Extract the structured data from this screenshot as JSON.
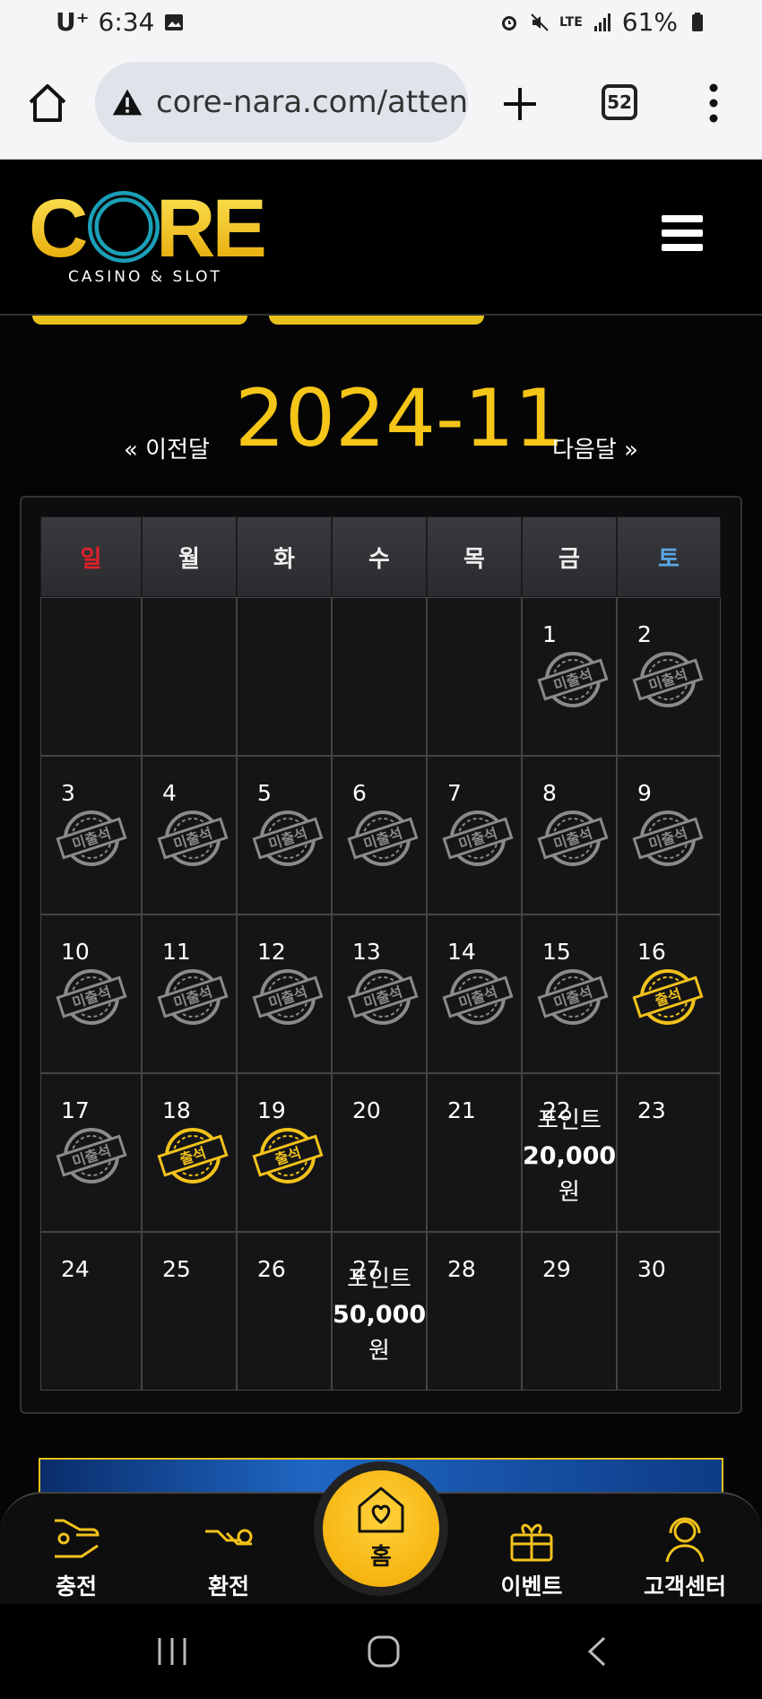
{
  "status_bar": {
    "carrier": "U⁺",
    "time": "6:34",
    "network": "LTE",
    "battery": "61%"
  },
  "browser": {
    "url": "core-nara.com/atten",
    "tab_count": "52"
  },
  "site": {
    "logo_text": "CORE",
    "logo_subtitle": "CASINO & SLOT"
  },
  "calendar": {
    "month_title": "2024-11",
    "prev_label": "« 이전달",
    "next_label": "다음달 »",
    "weekdays": [
      "일",
      "월",
      "화",
      "수",
      "목",
      "금",
      "토"
    ],
    "stamp_absent": "미출석",
    "stamp_present": "출석",
    "rows": [
      [
        {
          "day": ""
        },
        {
          "day": ""
        },
        {
          "day": ""
        },
        {
          "day": ""
        },
        {
          "day": ""
        },
        {
          "day": "1",
          "stamp": "absent"
        },
        {
          "day": "2",
          "stamp": "absent"
        }
      ],
      [
        {
          "day": "3",
          "stamp": "absent"
        },
        {
          "day": "4",
          "stamp": "absent"
        },
        {
          "day": "5",
          "stamp": "absent"
        },
        {
          "day": "6",
          "stamp": "absent"
        },
        {
          "day": "7",
          "stamp": "absent"
        },
        {
          "day": "8",
          "stamp": "absent"
        },
        {
          "day": "9",
          "stamp": "absent"
        }
      ],
      [
        {
          "day": "10",
          "stamp": "absent"
        },
        {
          "day": "11",
          "stamp": "absent"
        },
        {
          "day": "12",
          "stamp": "absent"
        },
        {
          "day": "13",
          "stamp": "absent"
        },
        {
          "day": "14",
          "stamp": "absent"
        },
        {
          "day": "15",
          "stamp": "absent"
        },
        {
          "day": "16",
          "stamp": "present"
        }
      ],
      [
        {
          "day": "17",
          "stamp": "absent"
        },
        {
          "day": "18",
          "stamp": "present"
        },
        {
          "day": "19",
          "stamp": "present"
        },
        {
          "day": "20"
        },
        {
          "day": "21"
        },
        {
          "day": "22",
          "reward": [
            "포인트",
            "20,000",
            "원"
          ]
        },
        {
          "day": "23"
        }
      ],
      [
        {
          "day": "24"
        },
        {
          "day": "25"
        },
        {
          "day": "26"
        },
        {
          "day": "27",
          "reward": [
            "포인트",
            "50,000",
            "원"
          ]
        },
        {
          "day": "28"
        },
        {
          "day": "29"
        },
        {
          "day": "30"
        }
      ]
    ]
  },
  "bottom_nav": {
    "items": [
      {
        "label": "충전",
        "icon": "deposit-icon"
      },
      {
        "label": "환전",
        "icon": "withdraw-icon"
      },
      {
        "label": "홈",
        "icon": "home-heart-icon"
      },
      {
        "label": "이벤트",
        "icon": "gift-icon"
      },
      {
        "label": "고객센터",
        "icon": "support-icon"
      }
    ]
  },
  "colors": {
    "accent_gold": "#f5c518",
    "sunday_red": "#e0202a",
    "saturday_blue": "#5aa7e6",
    "stamp_gray": "#8a8a8a",
    "stamp_gold": "#f2c21b"
  }
}
